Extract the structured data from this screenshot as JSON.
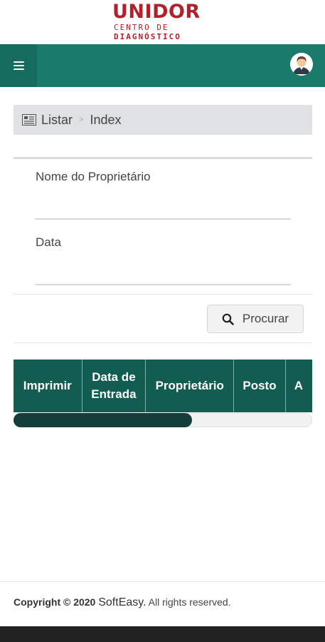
{
  "logo": {
    "title": "UNIDOR",
    "line1": "CENTRO DE",
    "line2": "DIAGNÓSTICO"
  },
  "colors": {
    "brand_red": "#b3202a",
    "topbar": "#1a7a6c",
    "table_header": "#125c52"
  },
  "topbar": {
    "menu_icon": "hamburger-icon",
    "avatar_icon": "user-avatar-icon"
  },
  "breadcrumb": {
    "icon": "list-icon",
    "items": [
      "Listar",
      "Index"
    ],
    "separator": ">"
  },
  "form": {
    "owner_label": "Nome do Proprietário",
    "owner_value": "",
    "date_label": "Data",
    "date_value": "",
    "search_button": "Procurar"
  },
  "table": {
    "columns": [
      "Imprimir",
      "Data de Entrada",
      "Proprietário",
      "Posto",
      "A"
    ]
  },
  "scrollbar": {
    "position": 0.6
  },
  "footer": {
    "copyright": "Copyright © 2020",
    "brand": "SoftEasy.",
    "rights": "All rights reserved."
  }
}
